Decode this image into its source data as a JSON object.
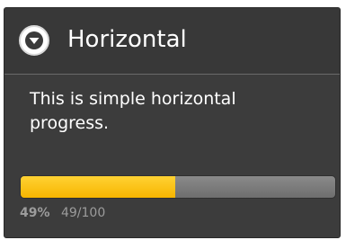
{
  "dialog": {
    "title": "Horizontal",
    "title_icon": "chevron-down-icon",
    "message": "This is simple horizontal progress."
  },
  "progress": {
    "value": 49,
    "max": 100,
    "fraction": 0.49,
    "percent_label": "49%",
    "count_label": "49/100",
    "fill_color": "#f7b500",
    "track_color": "#7a7a7a"
  }
}
